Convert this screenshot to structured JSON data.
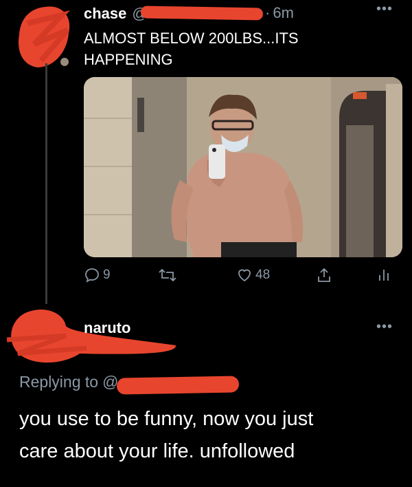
{
  "tweet": {
    "author_name": "chase",
    "handle_prefix": "@",
    "time": "6m",
    "separator": "·",
    "text_line1": "ALMOST BELOW 200LBS...ITS",
    "text_line2": "HAPPENING",
    "media_alt": "",
    "actions": {
      "reply_count": "9",
      "retweet_count": "",
      "like_count": "48"
    }
  },
  "reply": {
    "author_name": "naruto",
    "replying_to_label": "Replying to",
    "handle_prefix": "@",
    "text_line1": "you use to be funny, now you just",
    "text_line2": "care about your life. unfollowed"
  },
  "icons": {
    "reply": "reply-icon",
    "retweet": "retweet-icon",
    "like": "heart-icon",
    "share": "share-icon",
    "stats": "stats-icon",
    "more": "more-icon"
  },
  "colors": {
    "background": "#000000",
    "text": "#ffffff",
    "muted": "#8b98a5",
    "redaction": "#e8452f"
  }
}
